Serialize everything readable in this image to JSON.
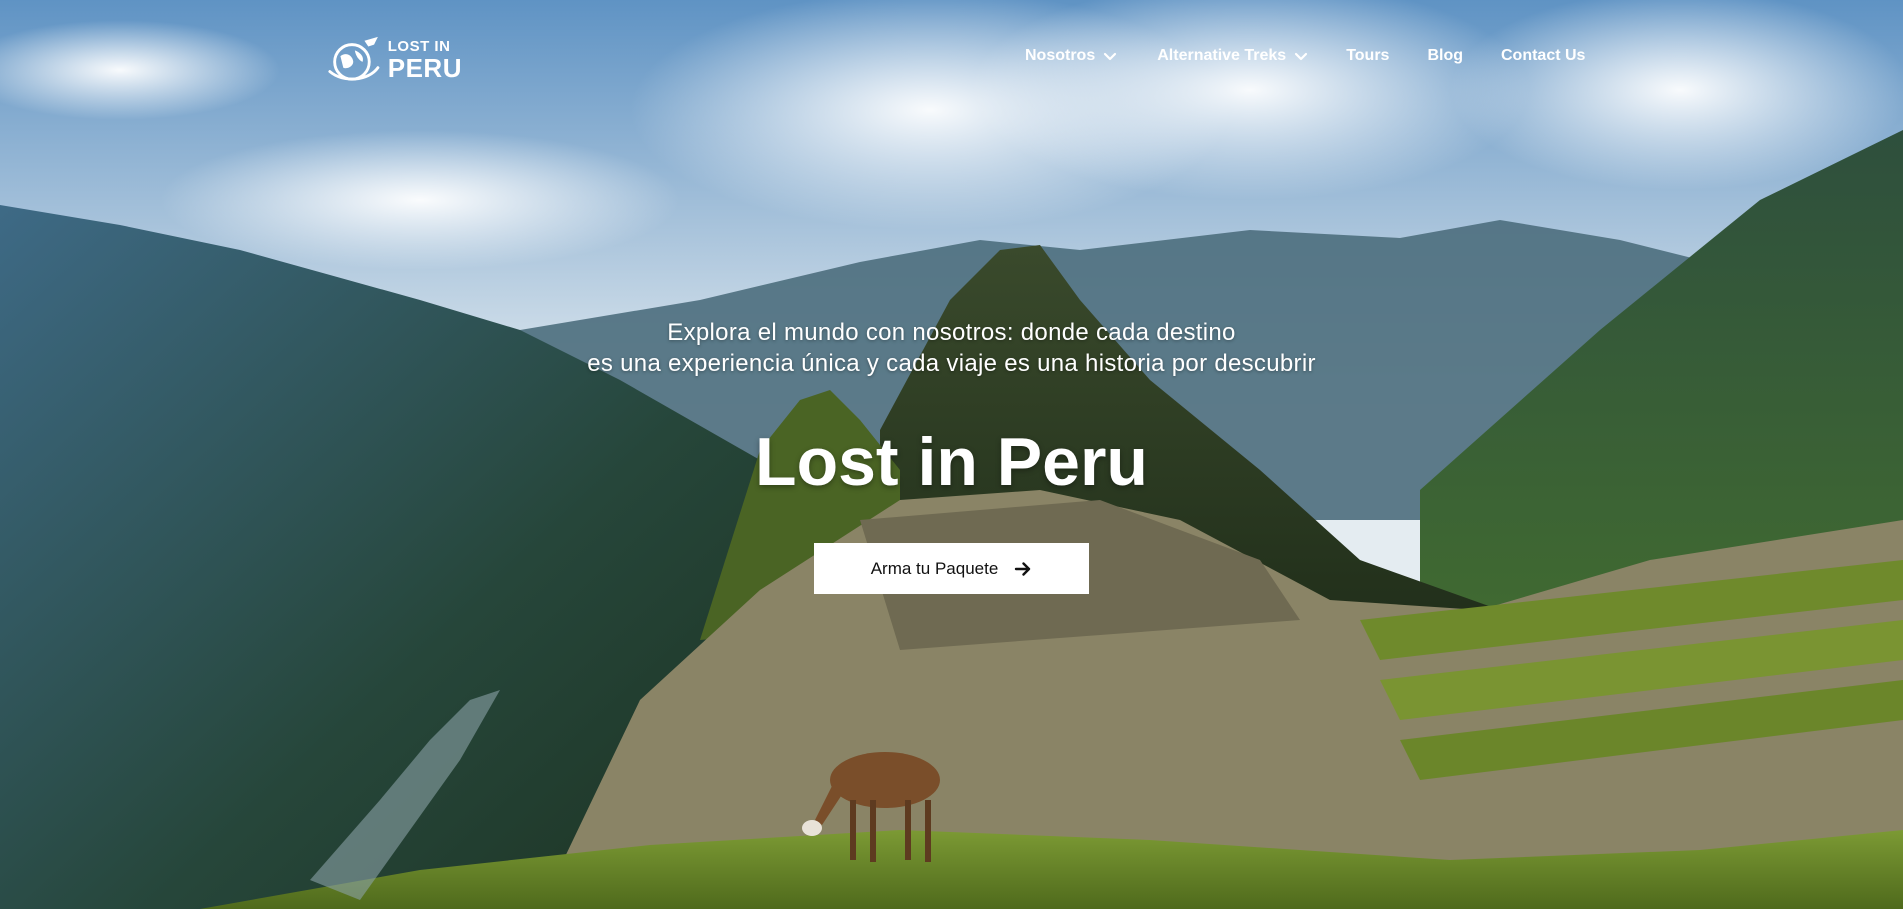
{
  "brand": {
    "line1": "LOST IN",
    "line2": "PERU"
  },
  "nav": {
    "items": [
      {
        "label": "Nosotros",
        "has_dropdown": true
      },
      {
        "label": "Alternative Treks",
        "has_dropdown": true
      },
      {
        "label": "Tours",
        "has_dropdown": false
      },
      {
        "label": "Blog",
        "has_dropdown": false
      },
      {
        "label": "Contact Us",
        "has_dropdown": false
      }
    ]
  },
  "hero": {
    "tagline_line1": "Explora el mundo con nosotros: donde cada destino",
    "tagline_line2": "es una experiencia única y cada viaje es una historia por descubrir",
    "title": "Lost in Peru",
    "cta_label": "Arma tu Paquete",
    "cta_icon": "arrow-right-icon"
  },
  "colors": {
    "text": "#ffffff",
    "button_bg": "#ffffff",
    "button_text": "#111111"
  }
}
